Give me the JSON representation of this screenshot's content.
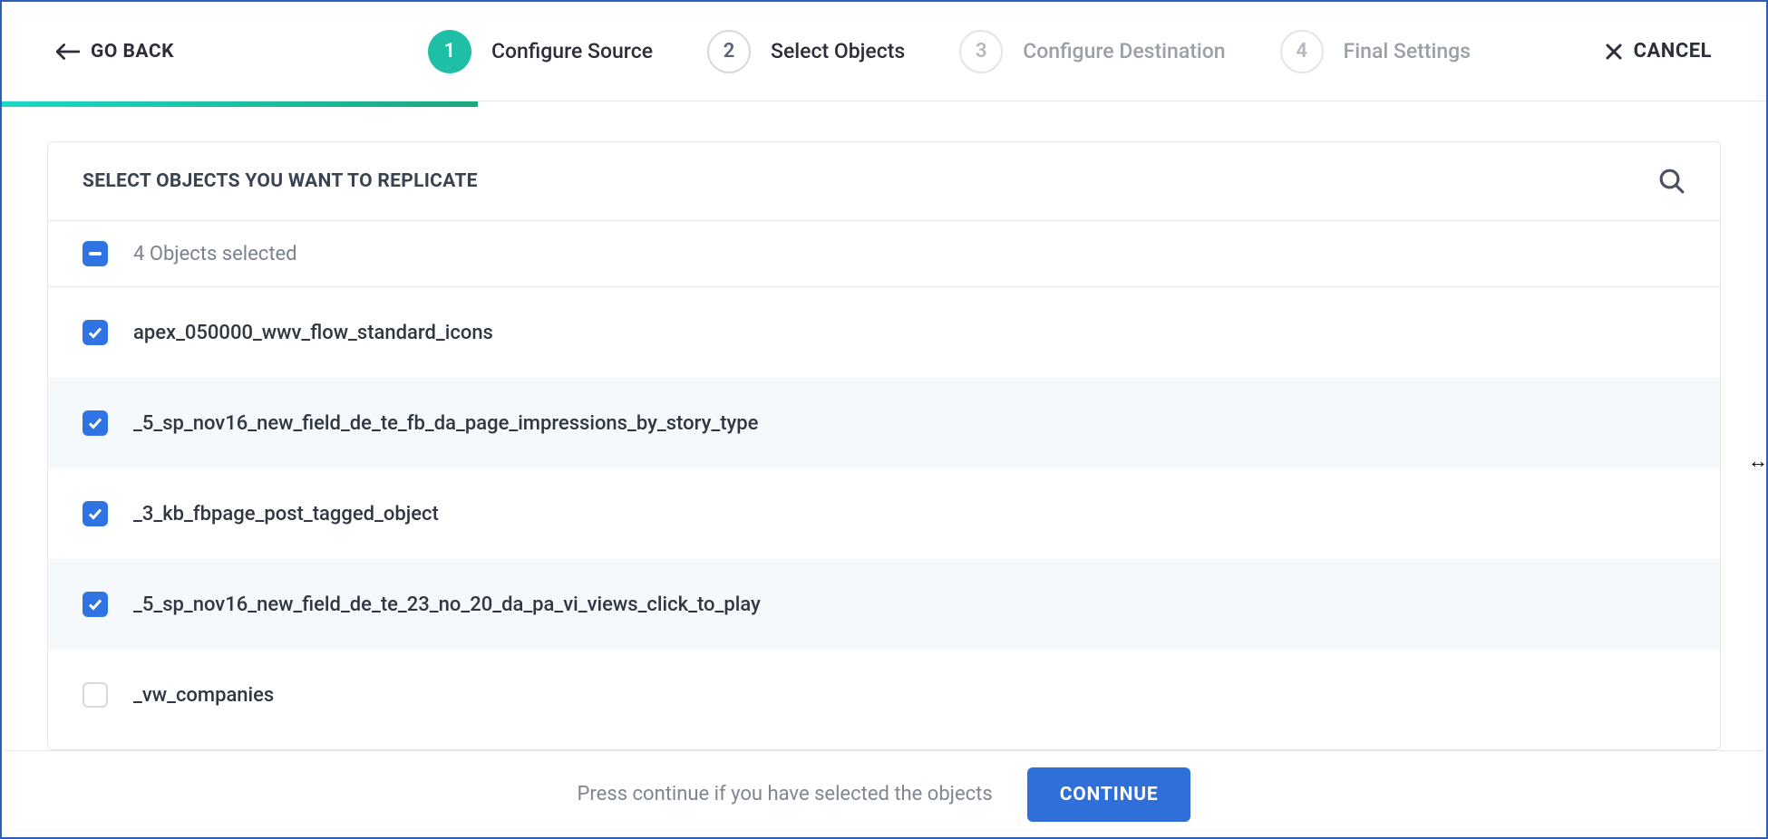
{
  "header": {
    "go_back": "GO BACK",
    "cancel": "CANCEL",
    "steps": [
      {
        "num": "1",
        "label": "Configure Source",
        "state": "active"
      },
      {
        "num": "2",
        "label": "Select Objects",
        "state": "inactive"
      },
      {
        "num": "3",
        "label": "Configure Destination",
        "state": "disabled"
      },
      {
        "num": "4",
        "label": "Final Settings",
        "state": "disabled"
      }
    ]
  },
  "panel": {
    "title": "SELECT OBJECTS YOU WANT TO REPLICATE",
    "summary": "4 Objects selected",
    "rows": [
      {
        "label": "apex_050000_wwv_flow_standard_icons",
        "checked": true,
        "alt": false
      },
      {
        "label": "_5_sp_nov16_new_field_de_te_fb_da_page_impressions_by_story_type",
        "checked": true,
        "alt": true
      },
      {
        "label": "_3_kb_fbpage_post_tagged_object",
        "checked": true,
        "alt": false
      },
      {
        "label": "_5_sp_nov16_new_field_de_te_23_no_20_da_pa_vi_views_click_to_play",
        "checked": true,
        "alt": true
      },
      {
        "label": "_vw_companies",
        "checked": false,
        "alt": false
      }
    ]
  },
  "footer": {
    "hint": "Press continue if you have selected the objects",
    "button": "CONTINUE"
  }
}
